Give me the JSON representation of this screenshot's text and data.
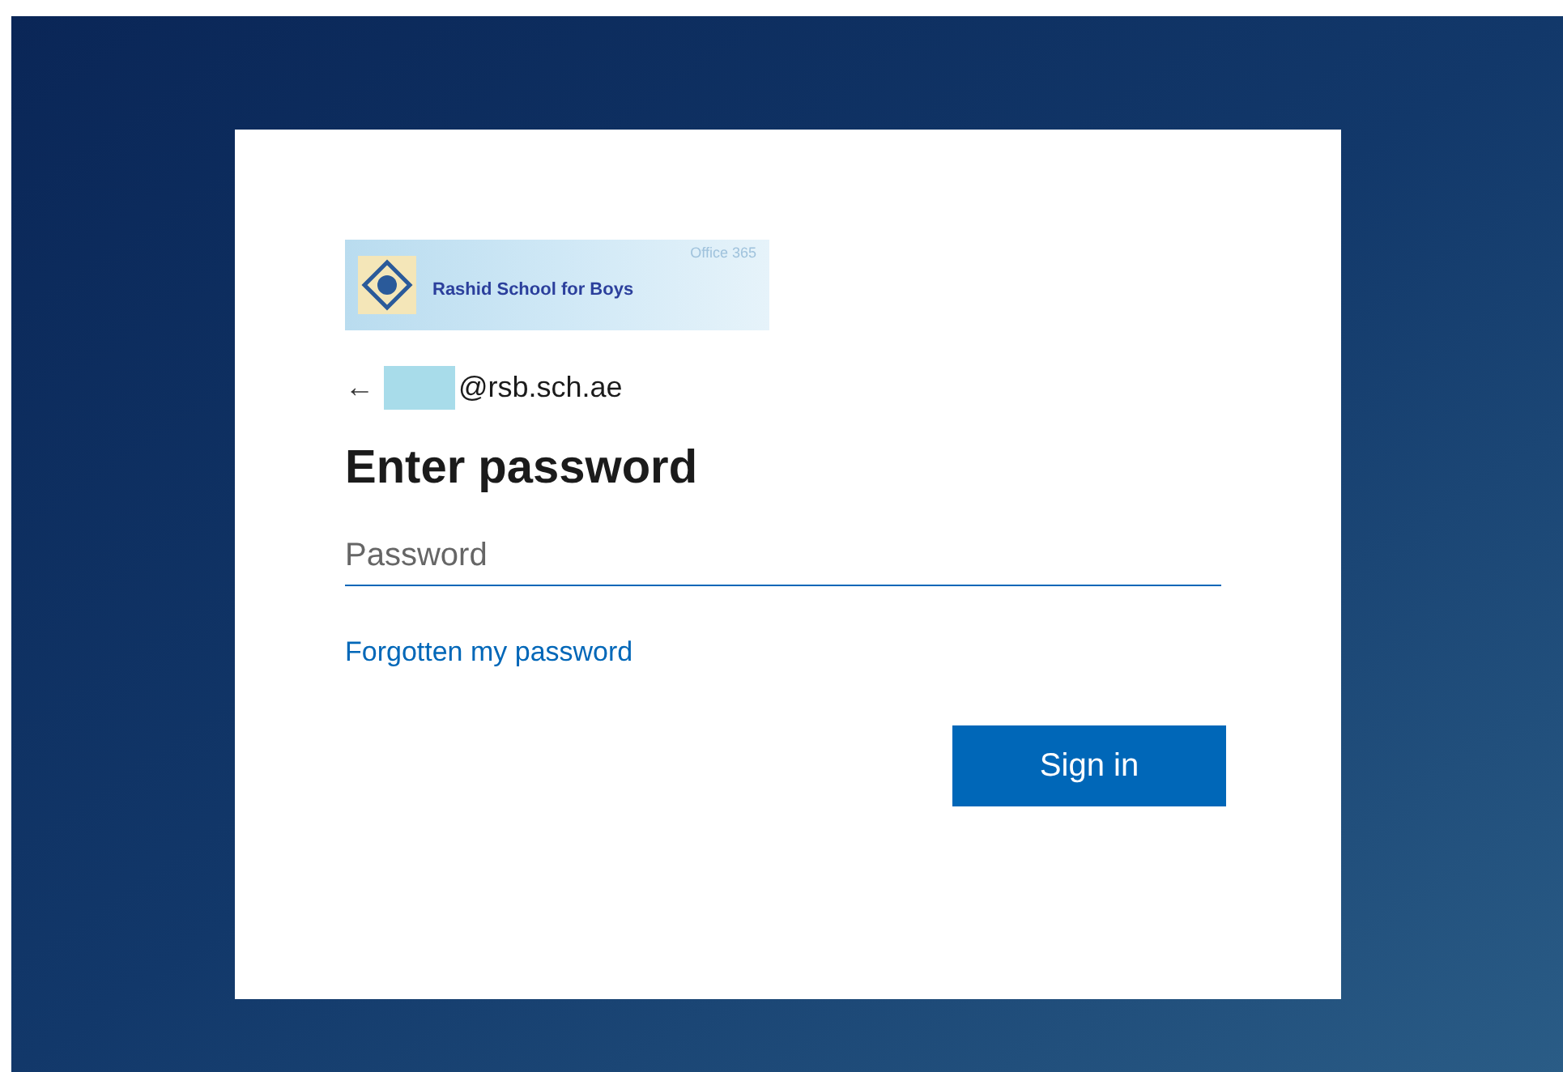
{
  "logo": {
    "school_name": "Rashid School for Boys",
    "product": "Office 365"
  },
  "account": {
    "back_icon": "←",
    "email": "@rsb.sch.ae"
  },
  "title": "Enter password",
  "password_field": {
    "placeholder": "Password"
  },
  "forgot_link": "Forgotten my password",
  "buttons": [
    "Sign in"
  ]
}
